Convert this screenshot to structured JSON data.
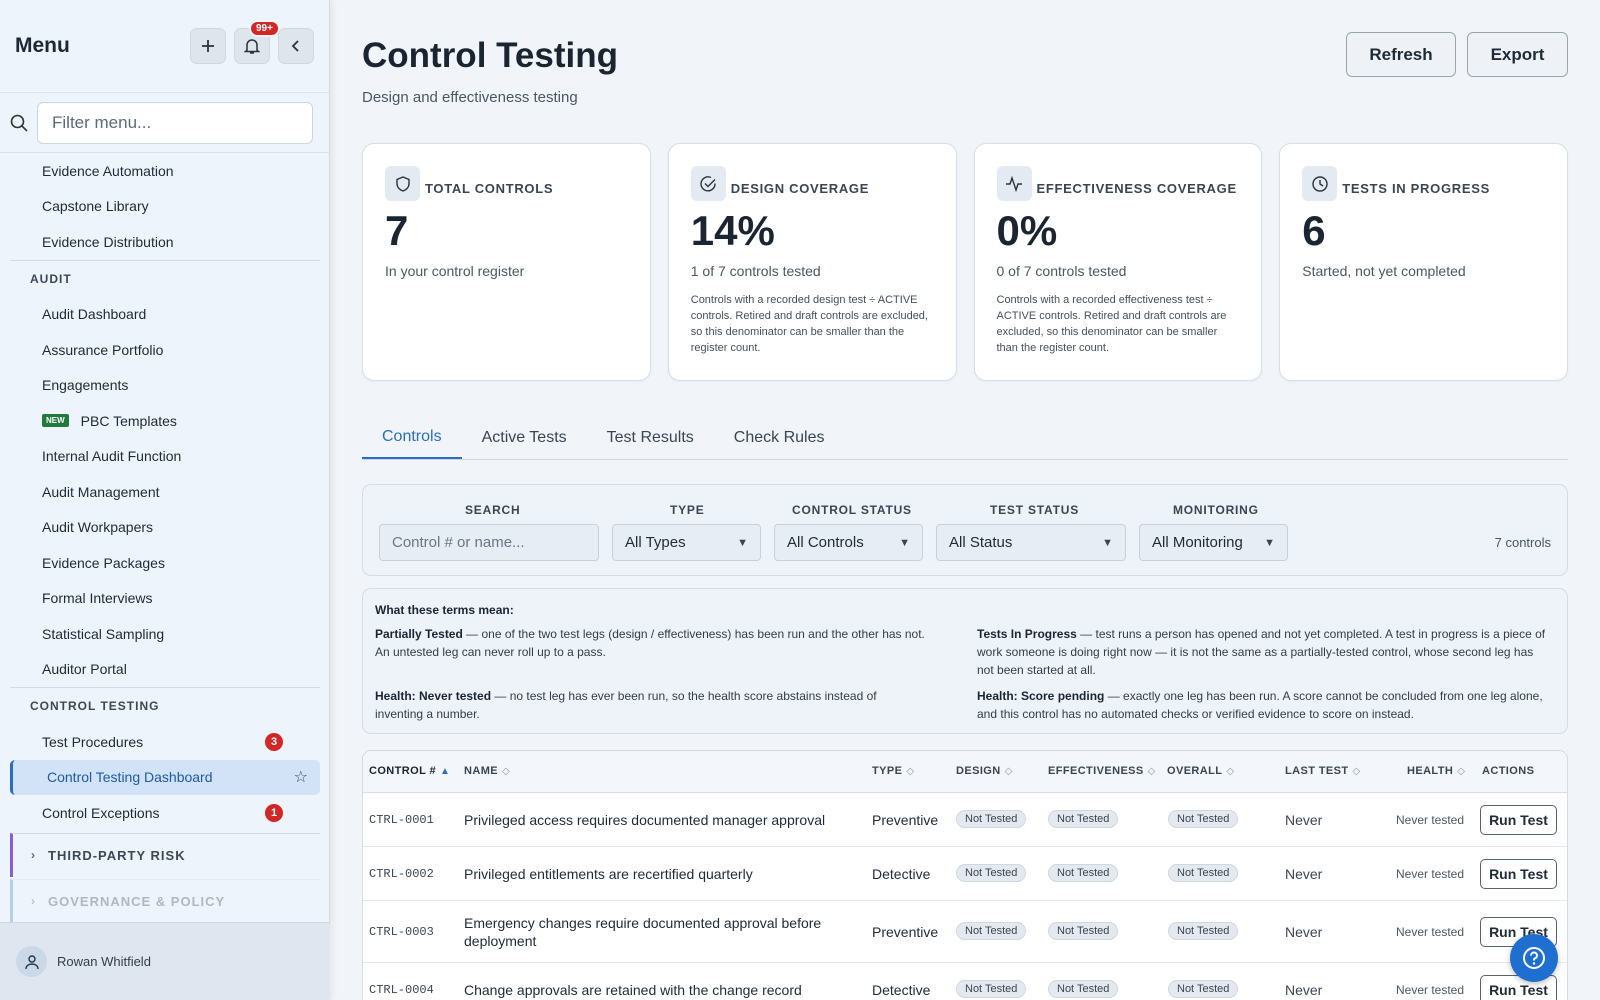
{
  "sidebar": {
    "title": "Menu",
    "notifications_badge": "99+",
    "filter_placeholder": "Filter menu...",
    "top_items": [
      "Evidence Automation",
      "Capstone Library",
      "Evidence Distribution"
    ],
    "audit_section": "AUDIT",
    "audit_items": [
      {
        "label": "Audit Dashboard"
      },
      {
        "label": "Assurance Portfolio"
      },
      {
        "label": "Engagements"
      },
      {
        "label": "PBC Templates",
        "tag": "NEW"
      },
      {
        "label": "Internal Audit Function"
      },
      {
        "label": "Audit Management"
      },
      {
        "label": "Audit Workpapers"
      },
      {
        "label": "Evidence Packages"
      },
      {
        "label": "Formal Interviews"
      },
      {
        "label": "Statistical Sampling"
      },
      {
        "label": "Auditor Portal"
      }
    ],
    "ct_section": "CONTROL TESTING",
    "ct_items": [
      {
        "label": "Test Procedures",
        "count": "3"
      },
      {
        "label": "Control Testing Dashboard"
      },
      {
        "label": "Control Exceptions",
        "count": "1"
      }
    ],
    "groups": [
      "THIRD-PARTY RISK",
      "GOVERNANCE & POLICY"
    ],
    "user": "Rowan Whitfield"
  },
  "header": {
    "title": "Control Testing",
    "subtitle": "Design and effectiveness testing",
    "refresh": "Refresh",
    "export": "Export"
  },
  "cards": [
    {
      "label": "TOTAL CONTROLS",
      "value": "7",
      "sub": "In your control register",
      "note": ""
    },
    {
      "label": "DESIGN COVERAGE",
      "value": "14%",
      "sub": "1 of 7 controls tested",
      "note": "Controls with a recorded design test ÷ ACTIVE controls. Retired and draft controls are excluded, so this denominator can be smaller than the register count."
    },
    {
      "label": "EFFECTIVENESS COVERAGE",
      "value": "0%",
      "sub": "0 of 7 controls tested",
      "note": "Controls with a recorded effectiveness test ÷ ACTIVE controls. Retired and draft controls are excluded, so this denominator can be smaller than the register count."
    },
    {
      "label": "TESTS IN PROGRESS",
      "value": "6",
      "sub": "Started, not yet completed",
      "note": ""
    }
  ],
  "tabs": [
    "Controls",
    "Active Tests",
    "Test Results",
    "Check Rules"
  ],
  "filters": {
    "search_label": "SEARCH",
    "search_placeholder": "Control # or name...",
    "type_label": "TYPE",
    "type_value": "All Types",
    "cstatus_label": "CONTROL STATUS",
    "cstatus_value": "All Controls",
    "tstatus_label": "TEST STATUS",
    "tstatus_value": "All Status",
    "monitoring_label": "MONITORING",
    "monitoring_value": "All Monitoring",
    "count": "7 controls"
  },
  "terms": {
    "title": "What these terms mean:",
    "t1_term": "Partially Tested",
    "t1_desc": " — one of the two test legs (design / effectiveness) has been run and the other has not. An untested leg can never roll up to a pass.",
    "t2_term": "Tests In Progress",
    "t2_desc": " — test runs a person has opened and not yet completed. A test in progress is a piece of work someone is doing right now — it is not the same as a partially-tested control, whose second leg has not been started at all.",
    "t3_term": "Health: Never tested",
    "t3_desc": " — no test leg has ever been run, so the health score abstains instead of inventing a number.",
    "t4_term": "Health: Score pending",
    "t4_desc": " — exactly one leg has been run. A score cannot be concluded from one leg alone, and this control has no automated checks or verified evidence to score on instead."
  },
  "table": {
    "columns": [
      "CONTROL #",
      "NAME",
      "TYPE",
      "DESIGN",
      "EFFECTIVENESS",
      "OVERALL",
      "LAST TEST",
      "HEALTH",
      "ACTIONS"
    ],
    "rows": [
      {
        "id": "CTRL-0001",
        "name": "Privileged access requires documented manager approval",
        "type": "Preventive",
        "design": "Not Tested",
        "eff": "Not Tested",
        "overall": "Not Tested",
        "last": "Never",
        "health": "Never tested",
        "action": "Run Test"
      },
      {
        "id": "CTRL-0002",
        "name": "Privileged entitlements are recertified quarterly",
        "type": "Detective",
        "design": "Not Tested",
        "eff": "Not Tested",
        "overall": "Not Tested",
        "last": "Never",
        "health": "Never tested",
        "action": "Run Test"
      },
      {
        "id": "CTRL-0003",
        "name": "Emergency changes require documented approval before deployment",
        "type": "Preventive",
        "design": "Not Tested",
        "eff": "Not Tested",
        "overall": "Not Tested",
        "last": "Never",
        "health": "Never tested",
        "action": "Run Test"
      },
      {
        "id": "CTRL-0004",
        "name": "Change approvals are retained with the change record",
        "type": "Detective",
        "design": "Not Tested",
        "eff": "Not Tested",
        "overall": "Not Tested",
        "last": "Never",
        "health": "Never tested",
        "action": "Run Test"
      }
    ]
  }
}
